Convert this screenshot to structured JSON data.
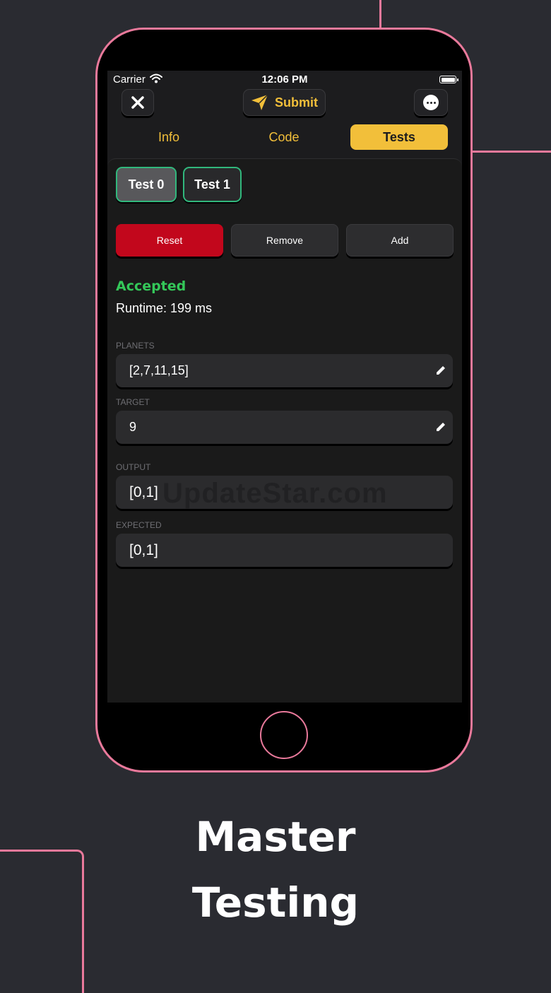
{
  "status_bar": {
    "carrier": "Carrier",
    "time": "12:06 PM"
  },
  "toolbar": {
    "submit_label": "Submit"
  },
  "segments": {
    "info": "Info",
    "code": "Code",
    "tests": "Tests",
    "selected": "Tests"
  },
  "test_tabs": [
    "Test 0",
    "Test 1"
  ],
  "actions": {
    "reset": "Reset",
    "remove": "Remove",
    "add": "Add"
  },
  "result": {
    "status": "Accepted",
    "runtime": "Runtime: 199 ms"
  },
  "fields": {
    "planets": {
      "label": "PLANETS",
      "value": "[2,7,11,15]"
    },
    "target": {
      "label": "TARGET",
      "value": "9"
    },
    "output": {
      "label": "OUTPUT",
      "value": "[0,1]"
    },
    "expected": {
      "label": "EXPECTED",
      "value": "[0,1]"
    }
  },
  "watermark": "UpdateStar.com",
  "caption": {
    "line1": "Master",
    "line2": "Testing"
  },
  "colors": {
    "accent_yellow": "#f2bf3a",
    "accepted_green": "#34c759",
    "reset_red": "#c2071c",
    "test_border": "#31b77c",
    "frame_pink": "#e9799b"
  }
}
